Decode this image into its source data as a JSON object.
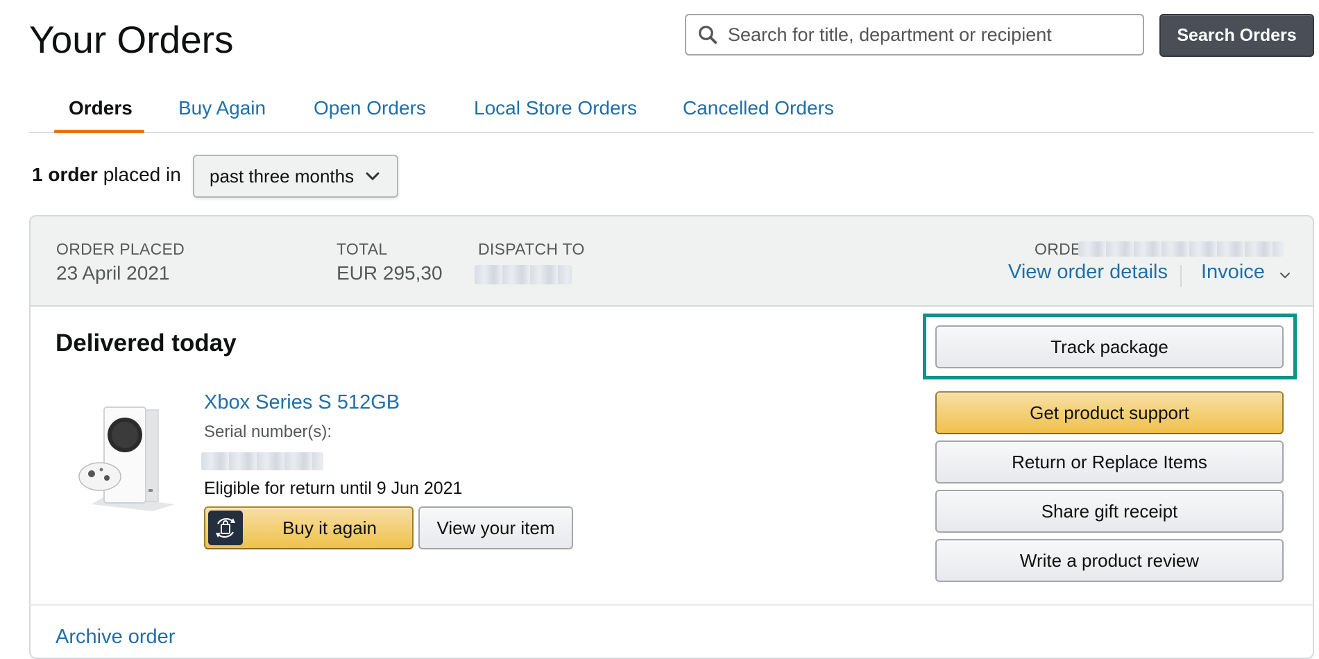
{
  "header": {
    "title": "Your Orders",
    "search_placeholder": "Search for title, department or recipient",
    "search_button": "Search Orders"
  },
  "tabs": [
    {
      "label": "Orders",
      "active": true
    },
    {
      "label": "Buy Again",
      "active": false
    },
    {
      "label": "Open Orders",
      "active": false
    },
    {
      "label": "Local Store Orders",
      "active": false
    },
    {
      "label": "Cancelled Orders",
      "active": false
    }
  ],
  "filter": {
    "count_strong": "1 order",
    "count_rest": "placed in",
    "period": "past three months"
  },
  "order": {
    "placed_label": "ORDER PLACED",
    "placed_value": "23 April 2021",
    "total_label": "TOTAL",
    "total_value": "EUR 295,30",
    "dispatch_label": "DISPATCH TO",
    "order_no_label": "ORDER #",
    "view_details": "View order details",
    "invoice": "Invoice",
    "status": "Delivered today",
    "product": {
      "title": "Xbox Series S 512GB",
      "serial_label": "Serial number(s):",
      "eligible": "Eligible for return until 9 Jun 2021"
    },
    "buy_again": "Buy it again",
    "view_item": "View your item",
    "actions": {
      "track": "Track package",
      "support": "Get product support",
      "return": "Return or Replace Items",
      "gift": "Share gift receipt",
      "review": "Write a product review"
    },
    "archive": "Archive order"
  },
  "colors": {
    "link": "#1f6fa8",
    "tab_underline": "#e77600",
    "highlight": "#0b9488",
    "button_yellow": "#f0c14b",
    "search_button": "#4a4f57"
  }
}
